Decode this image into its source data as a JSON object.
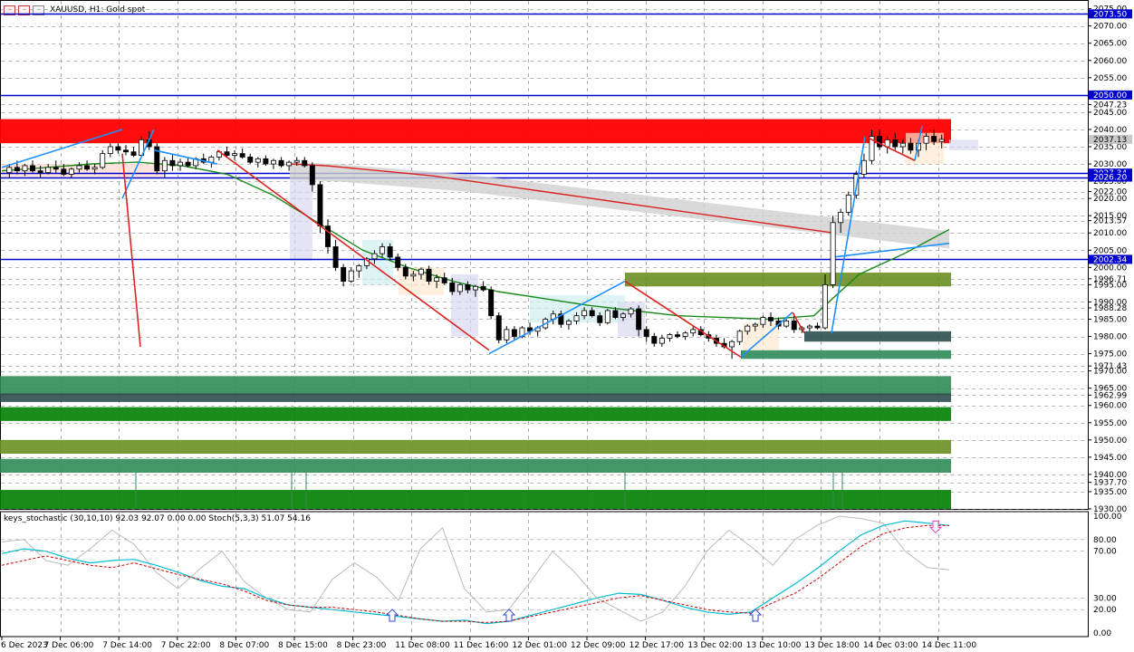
{
  "header": {
    "symbol": "XAUUSD, H1:  Gold spot",
    "icons": [
      "chart-list-icon",
      "chart-type-icon",
      "chart-settings-icon"
    ]
  },
  "oscillator": {
    "label": "keys_stochastic (30,10,10) 92.03 92.07 0.00 0.00 Stoch(5,3,3) 51.07 54.16",
    "levels": [
      "100.00",
      "80.00",
      "70.00",
      "30.00",
      "20.00",
      "0.00"
    ]
  },
  "colors": {
    "bull_candle": "#ffffff",
    "bear_candle": "#000000",
    "zone_red": "#ff0000",
    "zone_olive": "#6b8e23",
    "zone_sea": "#2e8b57",
    "zone_green": "#008000",
    "zone_slate": "#2f4f4f",
    "ma_green": "#1b8a1b",
    "ma_red": "#dd2222",
    "zigzag_blue": "#1e90ff",
    "level_blue": "#0000cd",
    "stoch_main": "#00bcd4",
    "stoch_signal": "#cc0000"
  },
  "price_axis": {
    "labels": [
      "2075.00",
      "2070.00",
      "2065.00",
      "2060.00",
      "2055.00",
      "2050.00",
      "2047.23",
      "2045.00",
      "2040.00",
      "2035.00",
      "2030.00",
      "2025.00",
      "2022.00",
      "2020.00",
      "2015.00",
      "2013.57",
      "2010.00",
      "2005.00",
      "2000.00",
      "1996.71",
      "1995.00",
      "1990.00",
      "1988.28",
      "1985.00",
      "1980.00",
      "1975.00",
      "1971.43",
      "1970.00",
      "1965.00",
      "1962.99",
      "1960.00",
      "1955.00",
      "1950.00",
      "1945.00",
      "1940.00",
      "1937.70",
      "1935.00",
      "1930.00"
    ],
    "highlight_labels": [
      {
        "text": "2073.50",
        "kind": "blue-line"
      },
      {
        "text": "2050.00",
        "kind": "blue-line"
      },
      {
        "text": "2037.13",
        "kind": "current-price"
      },
      {
        "text": "2027.34",
        "kind": "blue-line"
      },
      {
        "text": "2026.20",
        "kind": "blue-line"
      },
      {
        "text": "2002.34",
        "kind": "blue-line"
      }
    ]
  },
  "time_axis": {
    "labels": [
      "6 Dec 2023",
      "7 Dec 06:00",
      "7 Dec 14:00",
      "7 Dec 22:00",
      "8 Dec 07:00",
      "8 Dec 15:00",
      "8 Dec 23:00",
      "11 Dec 08:00",
      "11 Dec 16:00",
      "12 Dec 01:00",
      "12 Dec 09:00",
      "12 Dec 17:00",
      "13 Dec 02:00",
      "13 Dec 10:00",
      "13 Dec 18:00",
      "14 Dec 03:00",
      "14 Dec 11:00"
    ]
  },
  "chart_data": {
    "type": "candlestick",
    "symbol": "XAUUSD",
    "timeframe": "H1",
    "ylim": [
      1930,
      2077
    ],
    "ohlc": [
      [
        2027.5,
        2030,
        2026,
        2029
      ],
      [
        2029,
        2031,
        2027,
        2028
      ],
      [
        2028,
        2030,
        2026.5,
        2029.5
      ],
      [
        2029.5,
        2031,
        2027.5,
        2028
      ],
      [
        2028,
        2029.5,
        2026,
        2027.5
      ],
      [
        2027.5,
        2030,
        2027,
        2029
      ],
      [
        2029,
        2031,
        2027.5,
        2028.5
      ],
      [
        2028.5,
        2030,
        2026.5,
        2027
      ],
      [
        2027,
        2029,
        2026,
        2028.5
      ],
      [
        2028.5,
        2030.5,
        2027.5,
        2029.5
      ],
      [
        2029.5,
        2031,
        2028,
        2028.5
      ],
      [
        2028.5,
        2030,
        2027,
        2029
      ],
      [
        2029,
        2034,
        2028.5,
        2033
      ],
      [
        2033,
        2036,
        2032,
        2035
      ],
      [
        2035,
        2036,
        2033,
        2034
      ],
      [
        2034,
        2035.5,
        2032.5,
        2033.5
      ],
      [
        2033.5,
        2035,
        2032,
        2032.5
      ],
      [
        2032.5,
        2038,
        2032,
        2037
      ],
      [
        2037,
        2039.5,
        2034,
        2035
      ],
      [
        2035,
        2036,
        2027,
        2028
      ],
      [
        2028,
        2032,
        2026,
        2031
      ],
      [
        2031,
        2033,
        2028,
        2029.5
      ],
      [
        2029.5,
        2031.5,
        2028,
        2030.5
      ],
      [
        2030.5,
        2032,
        2029,
        2029.5
      ],
      [
        2029.5,
        2032,
        2028.5,
        2031.5
      ],
      [
        2031.5,
        2033,
        2030,
        2030.5
      ],
      [
        2030.5,
        2032.5,
        2029,
        2032
      ],
      [
        2032,
        2034,
        2031,
        2033.5
      ],
      [
        2033.5,
        2035,
        2032,
        2032.5
      ],
      [
        2032.5,
        2034,
        2031,
        2033
      ],
      [
        2033,
        2034.5,
        2031.5,
        2032
      ],
      [
        2032,
        2033,
        2030,
        2030.5
      ],
      [
        2030.5,
        2032,
        2029,
        2031.5
      ],
      [
        2031.5,
        2032.5,
        2029.5,
        2030
      ],
      [
        2030,
        2031.5,
        2028.5,
        2031
      ],
      [
        2031,
        2032,
        2029,
        2029.5
      ],
      [
        2029.5,
        2031,
        2028,
        2030.5
      ],
      [
        2030.5,
        2032,
        2029.5,
        2031
      ],
      [
        2031,
        2032,
        2029,
        2029.5
      ],
      [
        2029.5,
        2030.5,
        2022,
        2024
      ],
      [
        2024,
        2025,
        2010,
        2012
      ],
      [
        2012,
        2014,
        2004,
        2006
      ],
      [
        2006,
        2008,
        1999,
        2000
      ],
      [
        2000,
        2001,
        1994.5,
        1996
      ],
      [
        1996,
        2000,
        1995.5,
        1999
      ],
      [
        1999,
        2001,
        1997,
        2000.5
      ],
      [
        2000.5,
        2003,
        1999.5,
        2002.5
      ],
      [
        2002.5,
        2005,
        2001,
        2004
      ],
      [
        2004,
        2007,
        2003,
        2006
      ],
      [
        2006,
        2007,
        2002,
        2003
      ],
      [
        2003,
        2004,
        1999,
        2000
      ],
      [
        2000,
        2001,
        1996.5,
        1997.5
      ],
      [
        1997.5,
        1999,
        1996,
        1998
      ],
      [
        1998,
        2000,
        1996.5,
        1999.5
      ],
      [
        1999.5,
        2000.5,
        1995,
        1996
      ],
      [
        1996,
        1998,
        1994,
        1997
      ],
      [
        1997,
        1998.5,
        1995,
        1995.5
      ],
      [
        1995.5,
        1997,
        1992,
        1993
      ],
      [
        1993,
        1995.5,
        1992,
        1995
      ],
      [
        1995,
        1996,
        1992.5,
        1993.5
      ],
      [
        1993.5,
        1995,
        1991.5,
        1994.5
      ],
      [
        1994.5,
        1996,
        1993,
        1993.5
      ],
      [
        1993.5,
        1994.5,
        1985,
        1986
      ],
      [
        1986,
        1987,
        1978,
        1979
      ],
      [
        1979,
        1983,
        1978,
        1982
      ],
      [
        1982,
        1983,
        1979,
        1980
      ],
      [
        1980,
        1983,
        1979.5,
        1982.5
      ],
      [
        1982.5,
        1984,
        1980.5,
        1981.5
      ],
      [
        1981.5,
        1983,
        1980,
        1982.5
      ],
      [
        1982.5,
        1985.5,
        1982,
        1985
      ],
      [
        1985,
        1987.5,
        1983.5,
        1986.5
      ],
      [
        1986.5,
        1987.5,
        1982.5,
        1983.5
      ],
      [
        1983.5,
        1985,
        1982,
        1984.5
      ],
      [
        1984.5,
        1987,
        1983.5,
        1986
      ],
      [
        1986,
        1988.5,
        1985,
        1987.5
      ],
      [
        1987.5,
        1988.5,
        1985.5,
        1986
      ],
      [
        1986,
        1987,
        1983,
        1984
      ],
      [
        1984,
        1988,
        1983.5,
        1987.5
      ],
      [
        1987.5,
        1988.5,
        1985,
        1985.5
      ],
      [
        1985.5,
        1987,
        1984.5,
        1986.5
      ],
      [
        1986.5,
        1988.5,
        1985.5,
        1988
      ],
      [
        1988,
        1989,
        1980,
        1982
      ],
      [
        1982,
        1983,
        1978.5,
        1980
      ],
      [
        1980,
        1981,
        1977,
        1978
      ],
      [
        1978,
        1980.5,
        1977,
        1979.5
      ],
      [
        1979.5,
        1981,
        1978.5,
        1980.5
      ],
      [
        1980.5,
        1981.5,
        1979.5,
        1980
      ],
      [
        1980,
        1981.5,
        1979,
        1981
      ],
      [
        1981,
        1983,
        1980,
        1982
      ],
      [
        1982,
        1983,
        1980,
        1980.5
      ],
      [
        1980.5,
        1981.5,
        1978.5,
        1979.5
      ],
      [
        1979.5,
        1980.5,
        1977,
        1978
      ],
      [
        1978,
        1979.5,
        1976.5,
        1977
      ],
      [
        1977,
        1979,
        1973.5,
        1978.5
      ],
      [
        1978.5,
        1982,
        1977.5,
        1981.5
      ],
      [
        1981.5,
        1983.5,
        1980.5,
        1983
      ],
      [
        1983,
        1984,
        1981.5,
        1983.5
      ],
      [
        1983.5,
        1986,
        1982.5,
        1985.5
      ],
      [
        1985.5,
        1987,
        1983,
        1984.5
      ],
      [
        1984.5,
        1985.5,
        1982,
        1983
      ],
      [
        1983,
        1985,
        1982.5,
        1984.5
      ],
      [
        1984.5,
        1986,
        1981,
        1982
      ],
      [
        1982,
        1983,
        1981,
        1982.5
      ],
      [
        1982.5,
        1983.5,
        1981.5,
        1983
      ],
      [
        1983,
        1984,
        1982,
        1982.5
      ],
      [
        1982.5,
        1998,
        1982,
        1995
      ],
      [
        1995,
        2015,
        1994,
        2013
      ],
      [
        2013,
        2017,
        2010,
        2016
      ],
      [
        2016,
        2022,
        2015,
        2021
      ],
      [
        2021,
        2028,
        2020,
        2027
      ],
      [
        2027,
        2033,
        2026,
        2031
      ],
      [
        2031,
        2040,
        2030,
        2038
      ],
      [
        2038,
        2040,
        2034,
        2035
      ],
      [
        2035,
        2038,
        2033,
        2037
      ],
      [
        2037,
        2039,
        2034,
        2035
      ],
      [
        2035,
        2037,
        2033,
        2036
      ],
      [
        2036,
        2037.5,
        2033,
        2034
      ],
      [
        2034,
        2037,
        2032,
        2036
      ],
      [
        2036,
        2039,
        2034,
        2038
      ],
      [
        2038,
        2040,
        2035.5,
        2036.5
      ],
      [
        2036.5,
        2038.5,
        2034.5,
        2037.13
      ]
    ],
    "moving_averages": {
      "green": [
        2028,
        2029,
        2030,
        2030.5,
        2029.5,
        2027,
        2021,
        2013,
        2005,
        2000,
        1996,
        1993,
        1991,
        1989,
        1987.5,
        1986,
        1985.5,
        1985,
        1986,
        1998,
        2004,
        2011
      ],
      "red": [
        2030,
        2029.5,
        2028.5,
        2027.5,
        2026.5,
        2025,
        2023.5,
        2022,
        2020.5,
        2019,
        2017.5,
        2016,
        2014.5,
        2013,
        2011.5,
        2010
      ],
      "blue": [
        2003,
        2005,
        2007
      ]
    },
    "zigzag_blue": [
      [
        2029,
        2040
      ],
      [
        2020,
        2040
      ],
      [
        2034,
        2030
      ],
      [
        1975,
        1996
      ],
      [
        1974,
        1987
      ],
      [
        1981,
        2038
      ],
      [
        2031,
        2041
      ]
    ],
    "zigzag_red": [
      [
        2034,
        1976
      ],
      [
        2033,
        1977
      ],
      [
        1996,
        1974
      ],
      [
        1987,
        1981
      ],
      [
        2038,
        2031
      ]
    ],
    "horizontal_levels": [
      2073.5,
      2050.0,
      2027.34,
      2026.2,
      2002.34
    ],
    "zones": [
      {
        "color": "red",
        "from": 2036,
        "to": 2043
      },
      {
        "color": "olive",
        "from": 1994.5,
        "to": 1998.5
      },
      {
        "color": "slate",
        "from": 1978.5,
        "to": 1981.5
      },
      {
        "color": "sea",
        "from": 1973.5,
        "to": 1976
      },
      {
        "color": "sea",
        "from": 1963,
        "to": 1968.5
      },
      {
        "color": "slate",
        "from": 1961,
        "to": 1963.5
      },
      {
        "color": "green",
        "from": 1955.5,
        "to": 1959.5
      },
      {
        "color": "olive",
        "from": 1946,
        "to": 1950
      },
      {
        "color": "sea",
        "from": 1940.5,
        "to": 1944.5
      },
      {
        "color": "green",
        "from": 1930,
        "to": 1935.5
      }
    ],
    "stochastic": {
      "main": [
        68,
        72,
        70,
        64,
        60,
        62,
        63,
        58,
        52,
        45,
        40,
        38,
        30,
        24,
        22,
        20,
        18,
        16,
        14,
        12,
        10,
        11,
        8,
        10,
        15,
        20,
        25,
        30,
        34,
        33,
        28,
        22,
        18,
        16,
        18,
        30,
        42,
        55,
        70,
        84,
        92,
        96,
        94,
        92
      ],
      "signal": [
        58,
        62,
        66,
        62,
        58,
        56,
        60,
        55,
        50,
        46,
        42,
        36,
        28,
        24,
        22,
        22,
        20,
        18,
        15,
        12,
        10,
        10,
        9,
        10,
        14,
        18,
        22,
        26,
        30,
        32,
        28,
        24,
        20,
        18,
        17,
        26,
        34,
        46,
        60,
        74,
        85,
        90,
        92,
        92
      ],
      "ylim": [
        0,
        100
      ]
    }
  }
}
